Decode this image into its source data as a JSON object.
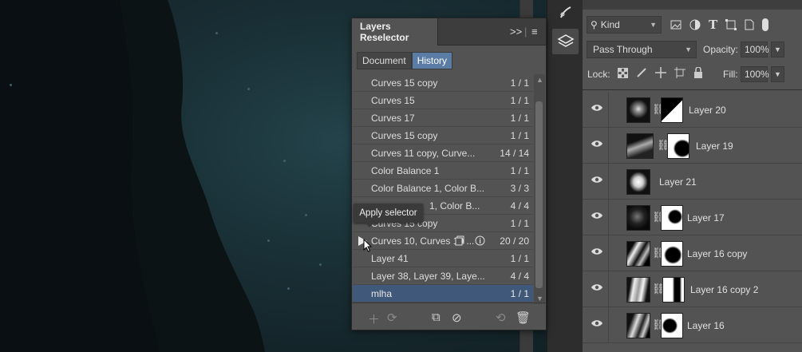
{
  "plugin": {
    "title": "Layers Reselector",
    "expand_label": ">>",
    "menu_label": "≡",
    "modes": [
      "Document",
      "History"
    ],
    "active_mode": "History",
    "rows": [
      {
        "label": "Curves 15 copy",
        "count": "1 / 1"
      },
      {
        "label": "Curves 15",
        "count": "1 / 1"
      },
      {
        "label": "Curves 17",
        "count": "1 / 1"
      },
      {
        "label": "Curves 15 copy",
        "count": "1 / 1"
      },
      {
        "label": "Curves 11 copy, Curve...",
        "count": "14 / 14"
      },
      {
        "label": "Color Balance 1",
        "count": "1 / 1"
      },
      {
        "label": "Color Balance 1, Color B...",
        "count": "3 / 3"
      },
      {
        "label": "1, Color B...",
        "count": "4 / 4"
      },
      {
        "label": "Curves 15 copy",
        "count": "1 / 1"
      },
      {
        "label": "Curves 10, Curves 10 ...",
        "count": "20 / 20"
      },
      {
        "label": "Layer 41",
        "count": "1 / 1"
      },
      {
        "label": "Layer 38, Layer 39, Laye...",
        "count": "4 / 4"
      },
      {
        "label": "mlha",
        "count": "1 / 1"
      }
    ],
    "tooltip": "Apply selector"
  },
  "layers_panel": {
    "kind_label": "Kind",
    "blend_mode": "Pass Through",
    "opacity_label": "Opacity:",
    "opacity_value": "100%",
    "lock_label": "Lock:",
    "fill_label": "Fill:",
    "fill_value": "100%",
    "layers": [
      {
        "name": "Layer 20",
        "has_mask": true
      },
      {
        "name": "Layer 19",
        "has_mask": true
      },
      {
        "name": "Layer 21",
        "has_mask": false
      },
      {
        "name": "Layer 17",
        "has_mask": true
      },
      {
        "name": "Layer 16 copy",
        "has_mask": true
      },
      {
        "name": "Layer 16 copy 2",
        "has_mask": true
      },
      {
        "name": "Layer 16",
        "has_mask": true
      }
    ]
  },
  "colors": {
    "selection": "#40587a",
    "active_tab": "#5b7da5",
    "panel_bg": "#535353"
  }
}
